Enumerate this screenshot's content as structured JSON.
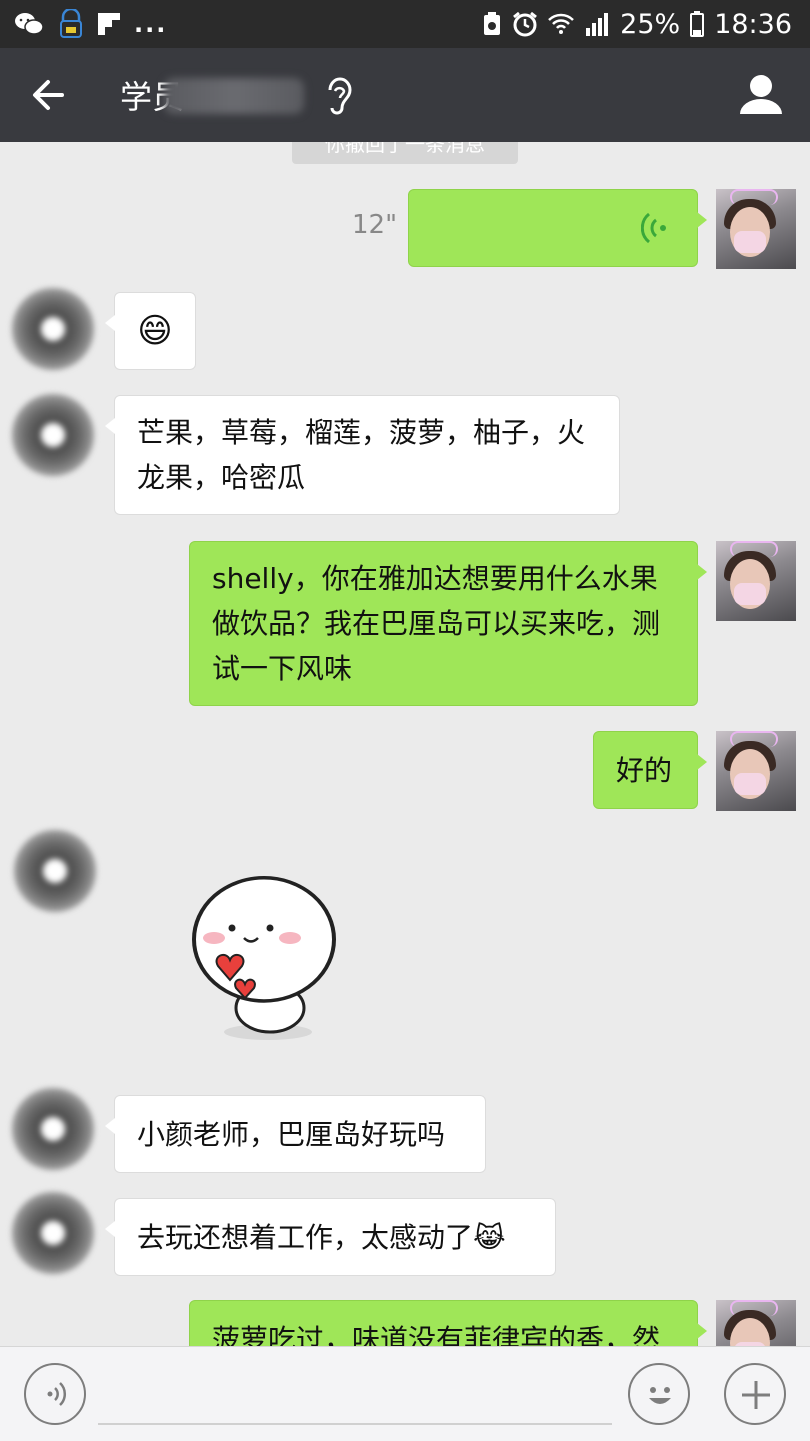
{
  "status_bar": {
    "dots": "...",
    "battery": "25%",
    "time": "18:36"
  },
  "header": {
    "title": "学员",
    "title_blurred": "shelley"
  },
  "system_notice": "你撤回了一条消息",
  "messages": [
    {
      "side": "out",
      "type": "voice",
      "duration": "12\""
    },
    {
      "side": "in",
      "type": "emoji",
      "text": "😄"
    },
    {
      "side": "in",
      "type": "text",
      "lines": [
        "芒果，草莓，榴莲，菠萝，柚子，火",
        "龙果，哈密瓜"
      ]
    },
    {
      "side": "out",
      "type": "text",
      "lines": [
        "shelly，你在雅加达想要用什么水果",
        "做饮品？我在巴厘岛可以买来吃，测",
        "试一下风味"
      ]
    },
    {
      "side": "out",
      "type": "text",
      "lines": [
        "好的"
      ]
    },
    {
      "side": "in",
      "type": "sticker"
    },
    {
      "side": "in",
      "type": "text",
      "lines": [
        "小颜老师，巴厘岛好玩吗"
      ]
    },
    {
      "side": "in",
      "type": "text",
      "lines": [
        "去玩还想着工作，太感动了😹"
      ]
    },
    {
      "side": "out",
      "type": "text",
      "lines": [
        "菠萝吃过，味道没有菲律宾的香，然"
      ]
    }
  ],
  "colors": {
    "chat_bg": "#ebebeb",
    "title_bar": "#393a3f",
    "status_bar": "#2b2b2b",
    "out_bubble": "#9fe658",
    "in_bubble": "#ffffff"
  },
  "icons": [
    "back-arrow-icon",
    "ear-icon",
    "profile-icon",
    "voice-wave-icon",
    "voice-mode-icon",
    "emoji-icon",
    "add-icon"
  ]
}
